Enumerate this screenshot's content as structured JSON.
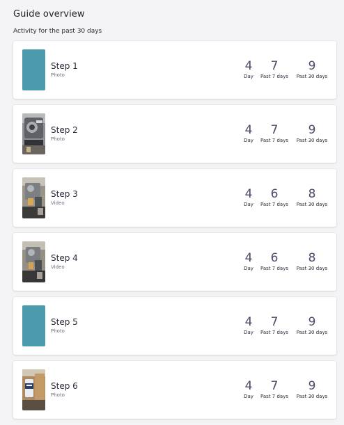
{
  "header": {
    "title": "Guide overview",
    "subtitle": "Activity for the past 30 days"
  },
  "stat_labels": {
    "day": "Day",
    "past7": "Past 7 days",
    "past30": "Past 30 days"
  },
  "steps": [
    {
      "name": "Step 1",
      "type": "Photo",
      "day": "4",
      "past7": "7",
      "past30": "9",
      "thumbnail": "teal-placeholder"
    },
    {
      "name": "Step 2",
      "type": "Photo",
      "day": "4",
      "past7": "7",
      "past30": "9",
      "thumbnail": "espresso-machine-photo"
    },
    {
      "name": "Step 3",
      "type": "Video",
      "day": "4",
      "past7": "6",
      "past30": "8",
      "thumbnail": "espresso-machine-video"
    },
    {
      "name": "Step 4",
      "type": "Video",
      "day": "4",
      "past7": "6",
      "past30": "8",
      "thumbnail": "espresso-machine-video"
    },
    {
      "name": "Step 5",
      "type": "Photo",
      "day": "4",
      "past7": "7",
      "past30": "9",
      "thumbnail": "teal-placeholder"
    },
    {
      "name": "Step 6",
      "type": "Photo",
      "day": "4",
      "past7": "7",
      "past30": "9",
      "thumbnail": "cup-and-box-photo"
    }
  ],
  "colors": {
    "placeholder": "#4c9aae",
    "number": "#4b4b6a",
    "background": "#f4f4f6"
  }
}
